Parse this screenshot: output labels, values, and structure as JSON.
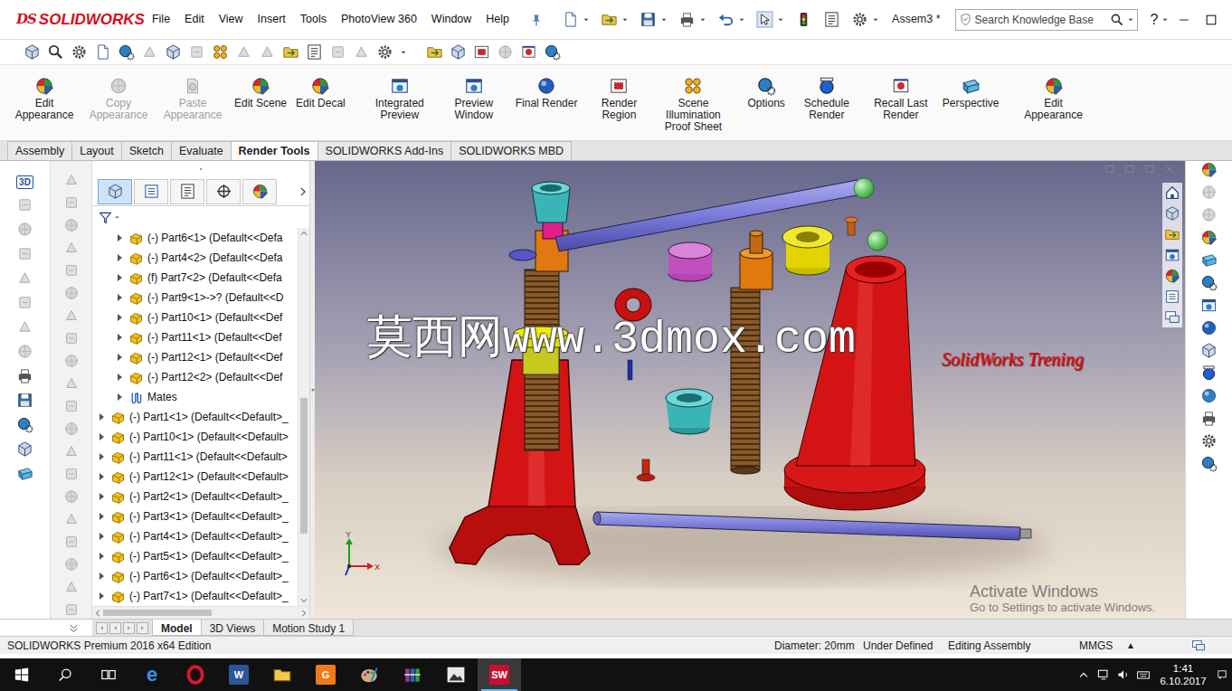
{
  "app": {
    "logo_mark": "DS",
    "logo_text": "SOLIDWORKS",
    "document": "Assem3 *"
  },
  "menu": [
    "File",
    "Edit",
    "View",
    "Insert",
    "Tools",
    "PhotoView 360",
    "Window",
    "Help"
  ],
  "search": {
    "placeholder": "Search Knowledge Base"
  },
  "help": "?",
  "ribbon": [
    {
      "label": "Edit Appearance",
      "disabled": false
    },
    {
      "label": "Copy Appearance",
      "disabled": true
    },
    {
      "label": "Paste Appearance",
      "disabled": true
    },
    {
      "label": "Edit Scene",
      "disabled": false
    },
    {
      "label": "Edit Decal",
      "disabled": false
    },
    {
      "label": "Integrated Preview",
      "disabled": false
    },
    {
      "label": "Preview Window",
      "disabled": false
    },
    {
      "label": "Final Render",
      "disabled": false
    },
    {
      "label": "Render Region",
      "disabled": false
    },
    {
      "label": "Scene Illumination Proof Sheet",
      "disabled": false
    },
    {
      "label": "Options",
      "disabled": false
    },
    {
      "label": "Schedule Render",
      "disabled": false
    },
    {
      "label": "Recall Last Render",
      "disabled": false
    },
    {
      "label": "Perspective",
      "disabled": false
    },
    {
      "label": "Edit Appearance",
      "disabled": false
    }
  ],
  "tabs": [
    {
      "label": "Assembly",
      "selected": false
    },
    {
      "label": "Layout",
      "selected": false
    },
    {
      "label": "Sketch",
      "selected": false
    },
    {
      "label": "Evaluate",
      "selected": false
    },
    {
      "label": "Render Tools",
      "selected": true
    },
    {
      "label": "SOLIDWORKS Add-Ins",
      "selected": false
    },
    {
      "label": "SOLIDWORKS MBD",
      "selected": false
    }
  ],
  "left_strip": {
    "view_label": "3D"
  },
  "tree": {
    "tabs": [
      {
        "selected": true
      },
      {
        "selected": false
      },
      {
        "selected": false
      },
      {
        "selected": false
      },
      {
        "selected": false
      }
    ],
    "sub_items": [
      {
        "label": "(-) Part6<1> (Default<<Defa",
        "kind": "part"
      },
      {
        "label": "(-) Part4<2> (Default<<Defa",
        "kind": "part"
      },
      {
        "label": "(f) Part7<2> (Default<<Defa",
        "kind": "part"
      },
      {
        "label": "(-) Part9<1>->? (Default<<D",
        "kind": "part"
      },
      {
        "label": "(-) Part10<1> (Default<<Def",
        "kind": "part"
      },
      {
        "label": "(-) Part11<1> (Default<<Def",
        "kind": "part"
      },
      {
        "label": "(-) Part12<1> (Default<<Def",
        "kind": "part"
      },
      {
        "label": "(-) Part12<2> (Default<<Def",
        "kind": "part"
      },
      {
        "label": "Mates",
        "kind": "mates"
      }
    ],
    "items": [
      {
        "label": "(-) Part1<1> (Default<<Default>_",
        "kind": "part"
      },
      {
        "label": "(-) Part10<1> (Default<<Default>",
        "kind": "part"
      },
      {
        "label": "(-) Part11<1> (Default<<Default>",
        "kind": "part"
      },
      {
        "label": "(-) Part12<1> (Default<<Default>",
        "kind": "part"
      },
      {
        "label": "(-) Part2<1> (Default<<Default>_",
        "kind": "part"
      },
      {
        "label": "(-) Part3<1> (Default<<Default>_",
        "kind": "part"
      },
      {
        "label": "(-) Part4<1> (Default<<Default>_",
        "kind": "part"
      },
      {
        "label": "(-) Part5<1> (Default<<Default>_",
        "kind": "part"
      },
      {
        "label": "(-) Part6<1> (Default<<Default>_",
        "kind": "part"
      },
      {
        "label": "(-) Part7<1> (Default<<Default>_",
        "kind": "part"
      }
    ],
    "scroll": {
      "level": 0.72
    },
    "h_scroll": {
      "level": 0
    }
  },
  "viewport": {
    "watermark": "莫西网www.3dmox.com",
    "caption": "SolidWorks Trening",
    "triad": {
      "y": "Y",
      "x": "X"
    },
    "activation": {
      "title": "Activate Windows",
      "hint": "Go to Settings to activate Windows."
    }
  },
  "bottom_tabs": [
    {
      "label": "Model",
      "selected": true
    },
    {
      "label": "3D Views",
      "selected": false
    },
    {
      "label": "Motion Study 1",
      "selected": false
    }
  ],
  "status_bar": {
    "edition": "SOLIDWORKS Premium 2016 x64 Edition",
    "measure": "Diameter: 20mm",
    "state": "Under Defined",
    "mode": "Editing Assembly",
    "units": "MMGS",
    "units_arrow": "▲"
  },
  "taskbar": {
    "apps": [
      {
        "kind": "glyph",
        "glyph": "e",
        "color": "#3a8ee6",
        "selected": false
      },
      {
        "kind": "ring",
        "glyph": "",
        "color": "#e0152b",
        "selected": false
      },
      {
        "kind": "tile",
        "glyph": "W",
        "color": "#2b579a",
        "selected": false
      },
      {
        "kind": "folder",
        "glyph": "",
        "color": "#f2c94c",
        "selected": false
      },
      {
        "kind": "tile",
        "glyph": "G",
        "color": "#f07a1a",
        "selected": false
      },
      {
        "kind": "palette",
        "glyph": "",
        "color": "#c9b27c",
        "selected": false
      },
      {
        "kind": "books",
        "glyph": "",
        "color": "#9a3a8a",
        "selected": false
      },
      {
        "kind": "picture",
        "glyph": "",
        "color": "#e8e8e8",
        "selected": false
      },
      {
        "kind": "tile",
        "glyph": "SW",
        "color": "#c8102e",
        "selected": true
      }
    ],
    "time": "1:41",
    "date": "6.10.2017"
  }
}
